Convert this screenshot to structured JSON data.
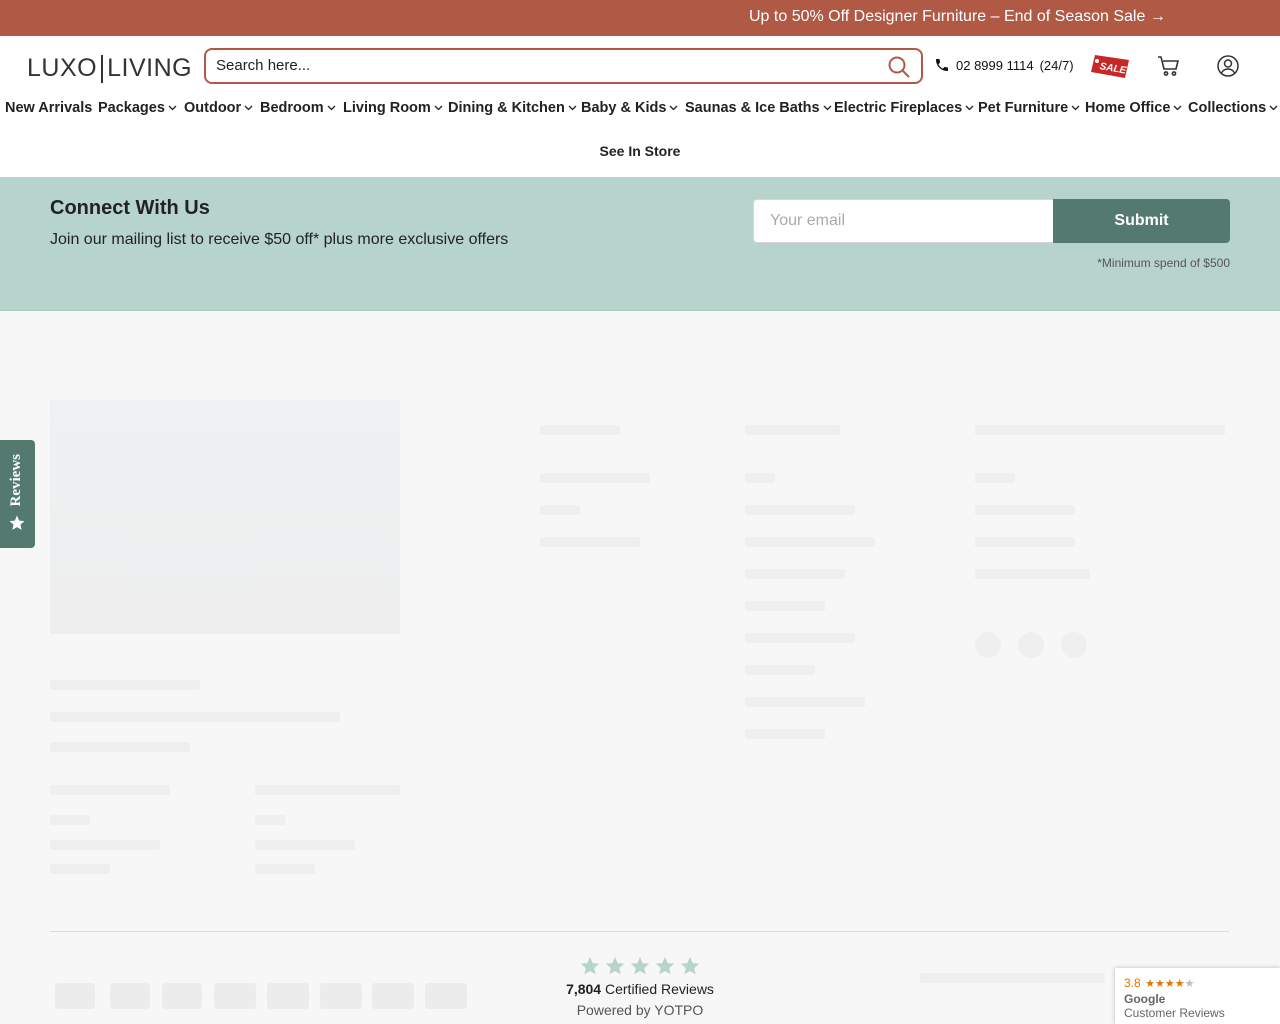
{
  "announcement": {
    "text": "Up to 50% Off Designer Furniture – End of Season Sale →"
  },
  "header": {
    "logo_left": "LUXO",
    "logo_right": "LIVING",
    "search_placeholder": "Search here...",
    "phone": "02 8999 1114",
    "phone_hours": "(24/7)",
    "sale_badge": "SALE"
  },
  "nav": {
    "items": [
      {
        "label": "New Arrivals",
        "has_dropdown": false
      },
      {
        "label": "Packages",
        "has_dropdown": true
      },
      {
        "label": "Outdoor",
        "has_dropdown": true
      },
      {
        "label": "Bedroom",
        "has_dropdown": true
      },
      {
        "label": "Living Room",
        "has_dropdown": true
      },
      {
        "label": "Dining & Kitchen",
        "has_dropdown": true
      },
      {
        "label": "Baby & Kids",
        "has_dropdown": true
      },
      {
        "label": "Saunas & Ice Baths",
        "has_dropdown": true
      },
      {
        "label": "Electric Fireplaces",
        "has_dropdown": true
      },
      {
        "label": "Pet Furniture",
        "has_dropdown": true
      },
      {
        "label": "Home Office",
        "has_dropdown": true
      },
      {
        "label": "Collections",
        "has_dropdown": true
      }
    ],
    "see_in_store": "See In Store"
  },
  "newsletter": {
    "title": "Connect With Us",
    "subtitle": "Join our mailing list to receive $50 off* plus more exclusive offers",
    "email_placeholder": "Your email",
    "submit_label": "Submit",
    "note": "*Minimum spend of $500"
  },
  "reviews_tab": {
    "label": "Reviews"
  },
  "yotpo": {
    "count": "7,804",
    "count_suffix": "Certified Reviews",
    "powered_by": "Powered by YOTPO",
    "star_rating": 5
  },
  "google_badge": {
    "rating": "3.8",
    "stars_filled": 4,
    "brand": "Google",
    "caption": "Customer Reviews"
  },
  "colors": {
    "announcement_bg": "#b05a46",
    "newsletter_bg": "#b7d4cc",
    "accent_green": "#547a6f",
    "star_color": "#b7d4cc",
    "google_orange": "#e37400"
  },
  "icons": {
    "search": "magnifier-icon",
    "phone": "phone-icon",
    "sale": "sale-tag-icon",
    "cart": "cart-icon",
    "account": "account-icon",
    "dropdown": "chevron-down-icon",
    "reviews": "star-icon"
  }
}
